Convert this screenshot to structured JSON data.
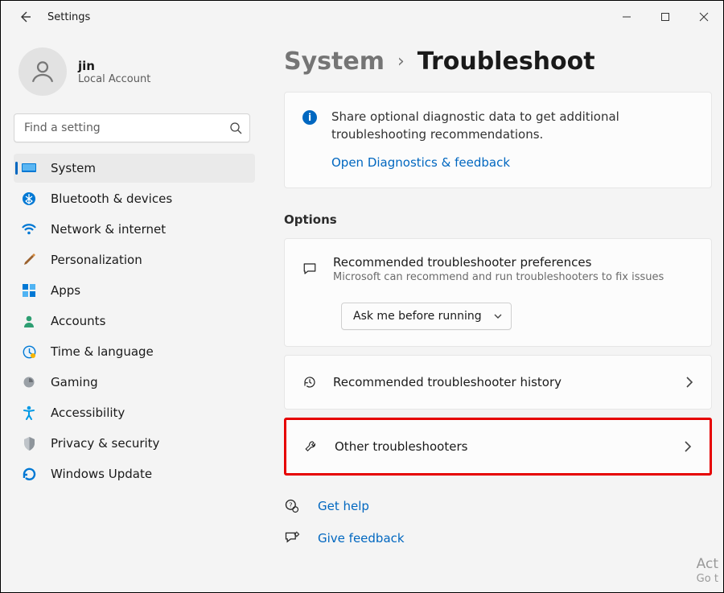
{
  "app": {
    "title": "Settings"
  },
  "user": {
    "name": "jin",
    "subtitle": "Local Account"
  },
  "search": {
    "placeholder": "Find a setting"
  },
  "sidebar": {
    "items": [
      {
        "label": "System",
        "icon": "system-icon",
        "active": true
      },
      {
        "label": "Bluetooth & devices",
        "icon": "bluetooth-icon",
        "active": false
      },
      {
        "label": "Network & internet",
        "icon": "wifi-icon",
        "active": false
      },
      {
        "label": "Personalization",
        "icon": "paintbrush-icon",
        "active": false
      },
      {
        "label": "Apps",
        "icon": "apps-icon",
        "active": false
      },
      {
        "label": "Accounts",
        "icon": "person-icon",
        "active": false
      },
      {
        "label": "Time & language",
        "icon": "clock-icon",
        "active": false
      },
      {
        "label": "Gaming",
        "icon": "gaming-icon",
        "active": false
      },
      {
        "label": "Accessibility",
        "icon": "accessibility-icon",
        "active": false
      },
      {
        "label": "Privacy & security",
        "icon": "shield-icon",
        "active": false
      },
      {
        "label": "Windows Update",
        "icon": "update-icon",
        "active": false
      }
    ]
  },
  "breadcrumb": {
    "parent": "System",
    "current": "Troubleshoot"
  },
  "diag": {
    "text": "Share optional diagnostic data to get additional troubleshooting recommendations.",
    "link": "Open Diagnostics & feedback"
  },
  "options": {
    "section": "Options",
    "recommended": {
      "title": "Recommended troubleshooter preferences",
      "sub": "Microsoft can recommend and run troubleshooters to fix issues",
      "dropdown": "Ask me before running"
    },
    "history": {
      "title": "Recommended troubleshooter history"
    },
    "other": {
      "title": "Other troubleshooters"
    }
  },
  "footer": {
    "help": "Get help",
    "feedback": "Give feedback"
  },
  "watermark": {
    "l1": "Act",
    "l2": "Go t"
  }
}
